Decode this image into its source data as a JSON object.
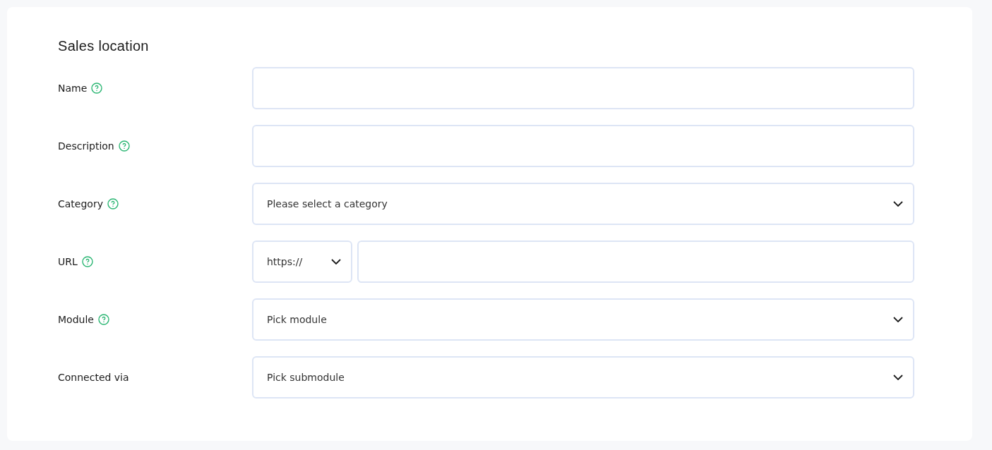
{
  "section": {
    "title": "Sales location"
  },
  "fields": [
    {
      "kind": "text",
      "label": "Name",
      "help": true
    },
    {
      "kind": "text",
      "label": "Description",
      "help": true
    },
    {
      "kind": "select",
      "label": "Category",
      "help": true,
      "placeholder": "Please select a category"
    },
    {
      "kind": "url",
      "label": "URL",
      "help": true,
      "scheme": "https://"
    },
    {
      "kind": "select",
      "label": "Module",
      "help": true,
      "placeholder": "Pick module"
    },
    {
      "kind": "select",
      "label": "Connected via",
      "help": false,
      "placeholder": "Pick submodule"
    }
  ]
}
